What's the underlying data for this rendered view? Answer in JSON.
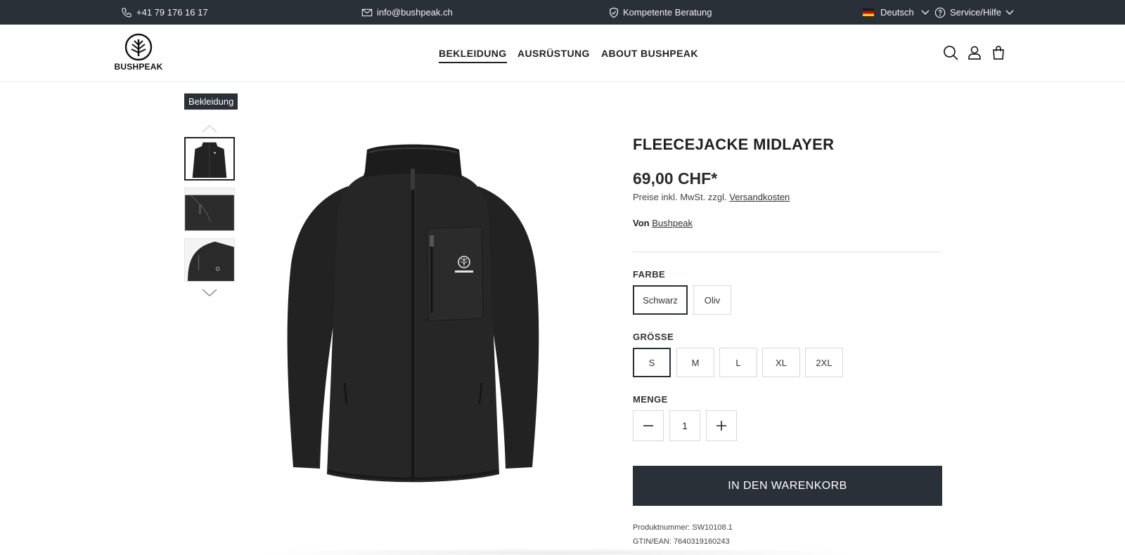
{
  "topbar": {
    "phone": "+41 79 176 16 17",
    "email": "info@bushpeak.ch",
    "consulting": "Kompetente Beratung",
    "language": "Deutsch",
    "service": "Service/Hilfe"
  },
  "header": {
    "logo_text": "BUSHPEAK",
    "nav": [
      "BEKLEIDUNG",
      "AUSRÜSTUNG",
      "ABOUT BUSHPEAK"
    ],
    "icons": [
      "search-icon",
      "account-icon",
      "cart-icon"
    ]
  },
  "breadcrumb": "Bekleidung",
  "product": {
    "title": "FLEECEJACKE MIDLAYER",
    "price": "69,00 CHF*",
    "tax_prefix": "Preise inkl. MwSt. zzgl.",
    "tax_link": "Versandkosten",
    "brand_prefix": "Von",
    "brand_link": "Bushpeak",
    "color_label": "FARBE",
    "colors": [
      "Schwarz",
      "Oliv"
    ],
    "selected_color": "Schwarz",
    "size_label": "GRÖSSE",
    "sizes": [
      "S",
      "M",
      "L",
      "XL",
      "2XL"
    ],
    "selected_size": "S",
    "qty_label": "MENGE",
    "qty": "1",
    "cart_label": "IN DEN WARENKORB",
    "product_number": "Produktnummer: SW10108.1",
    "gtin": "GTIN/EAN: 7640319160243"
  },
  "colors": {
    "dark": "#2a3038",
    "border": "#d8d8d8"
  }
}
